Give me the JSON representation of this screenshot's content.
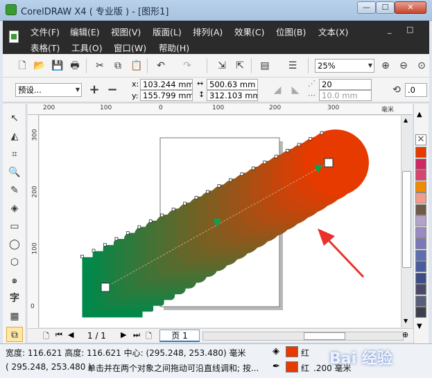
{
  "window": {
    "title": "CorelDRAW X4 ( 专业版 ) - [图形1]",
    "controls": {
      "minimize": "—",
      "maximize": "☐",
      "close": "✕"
    }
  },
  "menu": {
    "row1": [
      "文件(F)",
      "编辑(E)",
      "视图(V)",
      "版面(L)",
      "排列(A)",
      "效果(C)",
      "位图(B)",
      "文本(X)"
    ],
    "row2": [
      "表格(T)",
      "工具(O)",
      "窗口(W)",
      "帮助(H)"
    ],
    "mdi": "_ □ ✕"
  },
  "toolbar": {
    "zoom": "25%"
  },
  "property_bar": {
    "preset": "预设...",
    "x": "103.244 mm",
    "y": "155.799 mm",
    "width": "500.63 mm",
    "height": "312.103 mm",
    "steps": "20",
    "spacing": "10.0 mm",
    "angle": ".0"
  },
  "rulers": {
    "h": [
      "200",
      "100",
      "0",
      "100",
      "200",
      "300"
    ],
    "h_unit": "毫米",
    "v": [
      "300",
      "200",
      "100",
      "0"
    ]
  },
  "page_nav": {
    "counter": "1 / 1",
    "page_tab": "页 1"
  },
  "status": {
    "line1": "宽度: 116.621  高度: 116.621  中心: (295.248, 253.480)  毫米",
    "line2_coords": "( 295.248, 253.480 )",
    "line2_hint": "单击并在两个对象之间拖动可沿直线调和; 按...",
    "fill_label": "红",
    "outline_label": "红",
    "outline_width": ".200 毫米"
  },
  "watermark": "Bai 经验",
  "colors": {
    "start": "#00894a",
    "end": "#e63a00",
    "arrow": "#e8322b"
  },
  "icons": [
    "app-icon",
    "new-icon",
    "open-icon",
    "save-icon",
    "print-icon",
    "cut-icon",
    "copy-icon",
    "paste-icon",
    "undo-icon",
    "redo-icon",
    "import-icon",
    "export-icon",
    "zoom-in-icon",
    "zoom-out-icon"
  ]
}
